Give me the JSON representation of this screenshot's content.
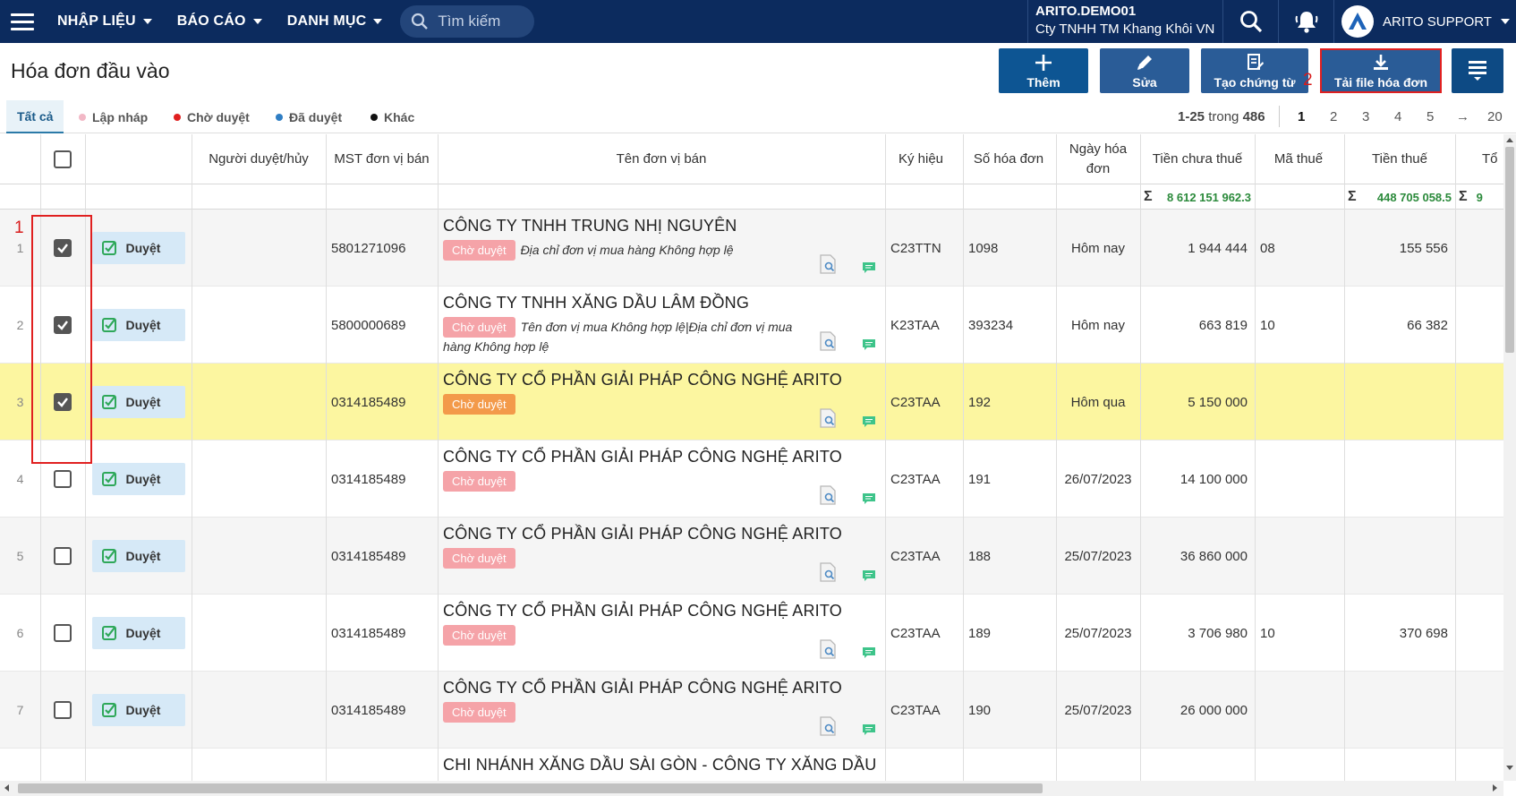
{
  "nav": {
    "items": [
      "NHẬP LIỆU",
      "BÁO CÁO",
      "DANH MỤC"
    ],
    "search_placeholder": "Tìm kiếm",
    "company_code": "ARITO.DEMO01",
    "company_name": "Cty TNHH TM Khang Khôi VN",
    "user_name": "ARITO SUPPORT"
  },
  "page": {
    "title": "Hóa đơn đầu vào",
    "buttons": {
      "add": "Thêm",
      "edit": "Sửa",
      "create_doc": "Tạo chứng từ",
      "download": "Tải file hóa đơn"
    },
    "annotations": [
      "1",
      "2"
    ]
  },
  "filters": {
    "tabs": [
      {
        "label": "Tất cả",
        "color": ""
      },
      {
        "label": "Lập nháp",
        "color": "#f2b8c6"
      },
      {
        "label": "Chờ duyệt",
        "color": "#e02020"
      },
      {
        "label": "Đã duyệt",
        "color": "#2f7ec4"
      },
      {
        "label": "Khác",
        "color": "#111111"
      }
    ]
  },
  "pager": {
    "range": "1-25",
    "of_label": "trong",
    "total": "486",
    "pages": [
      "1",
      "2",
      "3",
      "4",
      "5",
      "→",
      "20"
    ]
  },
  "grid": {
    "columns": {
      "approver": "Người duyệt/hủy",
      "tax_code": "MST đơn vị bán",
      "vendor": "Tên đơn vị bán",
      "symbol": "Ký hiệu",
      "invoice_no": "Số hóa đơn",
      "invoice_date": "Ngày hóa đơn",
      "pre_tax": "Tiền chưa thuế",
      "tax_rate": "Mã thuế",
      "tax_amount": "Tiền thuế",
      "total": "Tổ"
    },
    "summary": {
      "pre_tax": "8 612 151 962.3",
      "tax_amount": "448 705 058.5",
      "total": "9"
    },
    "approve_label": "Duyệt",
    "status_label": "Chờ duyệt",
    "status_color": "#f5a3a8",
    "status_color_selected": "#f39a4a",
    "rows": [
      {
        "num": "1",
        "checked": true,
        "tax_code": "5801271096",
        "vendor": "CÔNG TY TNHH TRUNG NHỊ NGUYÊN",
        "note": "Địa chỉ đơn vị mua hàng Không hợp lệ",
        "symbol": "C23TTN",
        "invoice_no": "1098",
        "date": "Hôm nay",
        "pre_tax": "1 944 444",
        "tax_rate": "08",
        "tax_amount": "155 556",
        "selected": false
      },
      {
        "num": "2",
        "checked": true,
        "tax_code": "5800000689",
        "vendor": "CÔNG TY TNHH XĂNG DẦU LÂM ĐỒNG",
        "note": "Tên đơn vị mua Không hợp lệ|Địa chỉ đơn vị mua hàng Không hợp lệ",
        "symbol": "K23TAA",
        "invoice_no": "393234",
        "date": "Hôm nay",
        "pre_tax": "663 819",
        "tax_rate": "10",
        "tax_amount": "66 382",
        "selected": false
      },
      {
        "num": "3",
        "checked": true,
        "tax_code": "0314185489",
        "vendor": "CÔNG TY CỔ PHẦN GIẢI PHÁP CÔNG NGHỆ ARITO",
        "note": "",
        "symbol": "C23TAA",
        "invoice_no": "192",
        "date": "Hôm qua",
        "pre_tax": "5 150 000",
        "tax_rate": "",
        "tax_amount": "",
        "selected": true
      },
      {
        "num": "4",
        "checked": false,
        "tax_code": "0314185489",
        "vendor": "CÔNG TY CỔ PHẦN GIẢI PHÁP CÔNG NGHỆ ARITO",
        "note": "",
        "symbol": "C23TAA",
        "invoice_no": "191",
        "date": "26/07/2023",
        "pre_tax": "14 100 000",
        "tax_rate": "",
        "tax_amount": "",
        "selected": false
      },
      {
        "num": "5",
        "checked": false,
        "tax_code": "0314185489",
        "vendor": "CÔNG TY CỔ PHẦN GIẢI PHÁP CÔNG NGHỆ ARITO",
        "note": "",
        "symbol": "C23TAA",
        "invoice_no": "188",
        "date": "25/07/2023",
        "pre_tax": "36 860 000",
        "tax_rate": "",
        "tax_amount": "",
        "selected": false
      },
      {
        "num": "6",
        "checked": false,
        "tax_code": "0314185489",
        "vendor": "CÔNG TY CỔ PHẦN GIẢI PHÁP CÔNG NGHỆ ARITO",
        "note": "",
        "symbol": "C23TAA",
        "invoice_no": "189",
        "date": "25/07/2023",
        "pre_tax": "3 706 980",
        "tax_rate": "10",
        "tax_amount": "370 698",
        "selected": false
      },
      {
        "num": "7",
        "checked": false,
        "tax_code": "0314185489",
        "vendor": "CÔNG TY CỔ PHẦN GIẢI PHÁP CÔNG NGHỆ ARITO",
        "note": "",
        "symbol": "C23TAA",
        "invoice_no": "190",
        "date": "25/07/2023",
        "pre_tax": "26 000 000",
        "tax_rate": "",
        "tax_amount": "",
        "selected": false
      }
    ],
    "partial_row_vendor": "CHI NHÁNH XĂNG DẦU SÀI GÒN - CÔNG TY XĂNG DẦU"
  },
  "colors": {
    "nav_bg": "#0c2b5e",
    "button_bg": "#2a5c97",
    "selected_row": "#fcf6a0",
    "sum_green": "#2b8a3b",
    "annotation_red": "#e02020"
  }
}
